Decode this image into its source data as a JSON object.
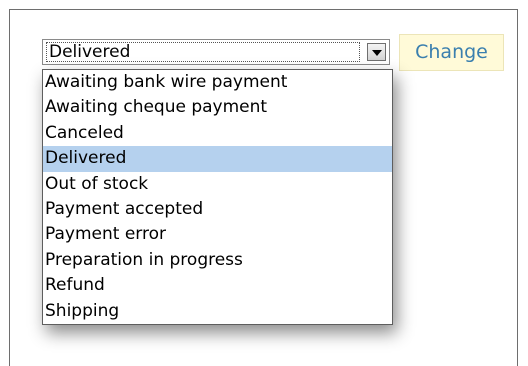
{
  "select": {
    "value": "Delivered",
    "options": [
      {
        "label": "Awaiting bank wire payment"
      },
      {
        "label": "Awaiting cheque payment"
      },
      {
        "label": "Canceled"
      },
      {
        "label": "Delivered"
      },
      {
        "label": "Out of stock"
      },
      {
        "label": "Payment accepted"
      },
      {
        "label": "Payment error"
      },
      {
        "label": "Preparation in progress"
      },
      {
        "label": "Refund"
      },
      {
        "label": "Shipping"
      }
    ]
  },
  "change_button": {
    "label": "Change"
  },
  "colors": {
    "highlight": "#b5d1ee",
    "button_bg": "#fffad8",
    "button_text": "#3a7fae"
  },
  "icons": {
    "dropdown": "chevron-down-icon"
  }
}
